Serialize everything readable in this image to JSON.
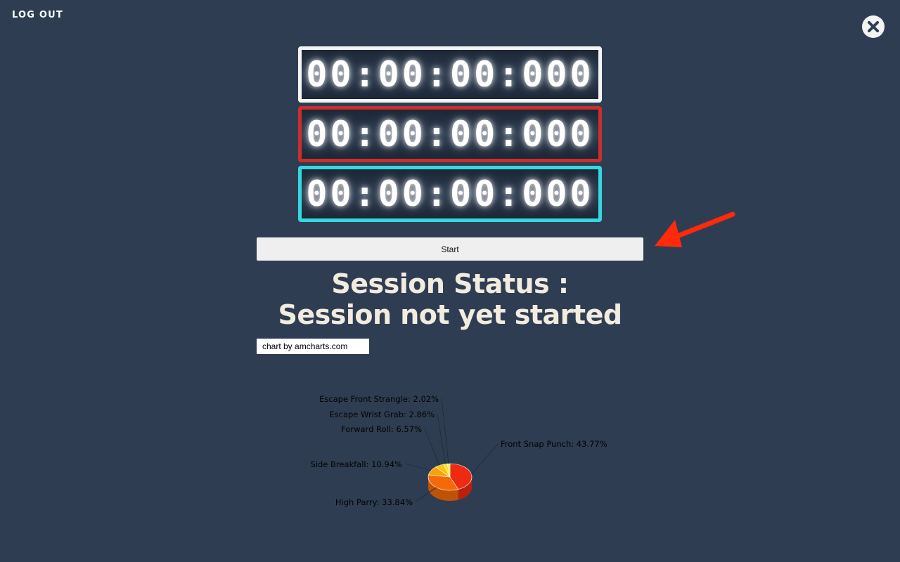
{
  "header": {
    "logout_label": "LOG OUT",
    "close_icon": "close-icon"
  },
  "timers": [
    {
      "display": "00:00:00:000",
      "border_color": "#f4f4f4"
    },
    {
      "display": "00:00:00:000",
      "border_color": "#c9302c"
    },
    {
      "display": "00:00:00:000",
      "border_color": "#34d8e0"
    }
  ],
  "start_button": {
    "label": "Start"
  },
  "annotation": {
    "arrow_color": "#ff2a0a"
  },
  "session": {
    "status_label": "Session Status :",
    "status_value": "Session not yet started"
  },
  "chart_credit": "chart by amcharts.com",
  "chart_data": {
    "type": "pie",
    "slices": [
      {
        "name": "Front Snap Punch",
        "value": 43.77,
        "label": "Front Snap Punch: 43.77%",
        "color": "#ee2a10"
      },
      {
        "name": "High Parry",
        "value": 33.84,
        "label": "High Parry: 33.84%",
        "color": "#f46a0a"
      },
      {
        "name": "Side Breakfall",
        "value": 10.94,
        "label": "Side Breakfall: 10.94%",
        "color": "#f8a408"
      },
      {
        "name": "Forward Roll",
        "value": 6.57,
        "label": "Forward Roll: 6.57%",
        "color": "#fbc412"
      },
      {
        "name": "Escape Wrist Grab",
        "value": 2.86,
        "label": "Escape Wrist Grab: 2.86%",
        "color": "#fde021"
      },
      {
        "name": "Escape Front Strangle",
        "value": 2.02,
        "label": "Escape Front Strangle: 2.02%",
        "color": "#fff04a"
      }
    ]
  }
}
